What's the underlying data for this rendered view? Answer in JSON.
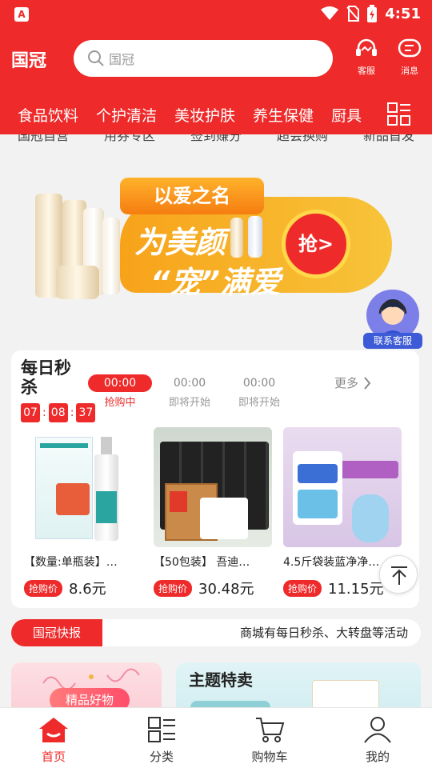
{
  "status_bar": {
    "time": "4:51"
  },
  "header": {
    "logo": "国冠",
    "search_placeholder": "国冠",
    "service_label": "客服",
    "message_label": "消息"
  },
  "categories": [
    "食品饮料",
    "个护清洁",
    "美妆护肤",
    "养生保健",
    "厨具"
  ],
  "sub_nav": [
    "国冠自营",
    "用券专区",
    "签到赚分",
    "超会换购",
    "新品首发"
  ],
  "banner": {
    "tag": "以爱之名",
    "line1": "为美颜",
    "line2": "“宠”满爱",
    "button": "抢>"
  },
  "customer_service": {
    "label": "联系客服"
  },
  "flash_sale": {
    "title": "每日秒杀",
    "countdown": [
      "07",
      "08",
      "37"
    ],
    "slots": [
      {
        "time": "00:00",
        "status": "抢购中"
      },
      {
        "time": "00:00",
        "status": "即将开始"
      },
      {
        "time": "00:00",
        "status": "即将开始"
      }
    ],
    "more": "更多",
    "products": [
      {
        "name": "【数量:单瓶装】…",
        "price_tag": "抢购价",
        "price": "8.6元"
      },
      {
        "name": "【50包装】 吾迪…",
        "price_tag": "抢购价",
        "price": "30.48元"
      },
      {
        "name": "4.5斤袋装蓝净净…",
        "price_tag": "抢购价",
        "price": "11.15元"
      }
    ]
  },
  "news": {
    "tag": "国冠快报",
    "text": "商城有每日秒杀、大转盘等活动"
  },
  "promo_cards": {
    "left_label": "精品好物",
    "right_title": "主题特卖"
  },
  "tab_bar": [
    {
      "label": "首页",
      "icon": "home-icon"
    },
    {
      "label": "分类",
      "icon": "category-icon"
    },
    {
      "label": "购物车",
      "icon": "cart-icon"
    },
    {
      "label": "我的",
      "icon": "profile-icon"
    }
  ],
  "colors": {
    "brand_red": "#ee2a2a",
    "banner_orange": "#f7a31a"
  }
}
